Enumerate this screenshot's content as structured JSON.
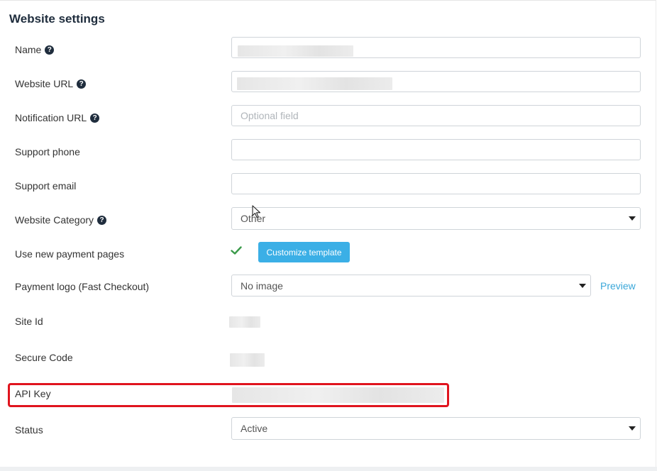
{
  "page": {
    "title": "Website settings"
  },
  "fields": {
    "name": {
      "label": "Name",
      "value": ""
    },
    "website_url": {
      "label": "Website URL",
      "value": ""
    },
    "notification_url": {
      "label": "Notification URL",
      "value": "",
      "placeholder": "Optional field"
    },
    "support_phone": {
      "label": "Support phone",
      "value": ""
    },
    "support_email": {
      "label": "Support email",
      "value": ""
    },
    "website_category": {
      "label": "Website Category",
      "value": "Other"
    },
    "use_new_payment_pages": {
      "label": "Use new payment pages",
      "checked": true,
      "button_label": "Customize template"
    },
    "payment_logo": {
      "label": "Payment logo (Fast Checkout)",
      "value": "No image",
      "link_label": "Preview"
    },
    "site_id": {
      "label": "Site Id"
    },
    "secure_code": {
      "label": "Secure Code"
    },
    "api_key": {
      "label": "API Key"
    },
    "status": {
      "label": "Status",
      "value": "Active"
    }
  },
  "icons": {
    "help": "question-circle-icon",
    "check": "checkmark-icon",
    "dropdown": "caret-down-icon",
    "cursor": "mouse-pointer-icon"
  },
  "colors": {
    "accent": "#3bafe6",
    "link": "#3aa7d9",
    "check": "#3a9a4a",
    "highlight": "#e0141e",
    "heading": "#1f2d3d"
  }
}
